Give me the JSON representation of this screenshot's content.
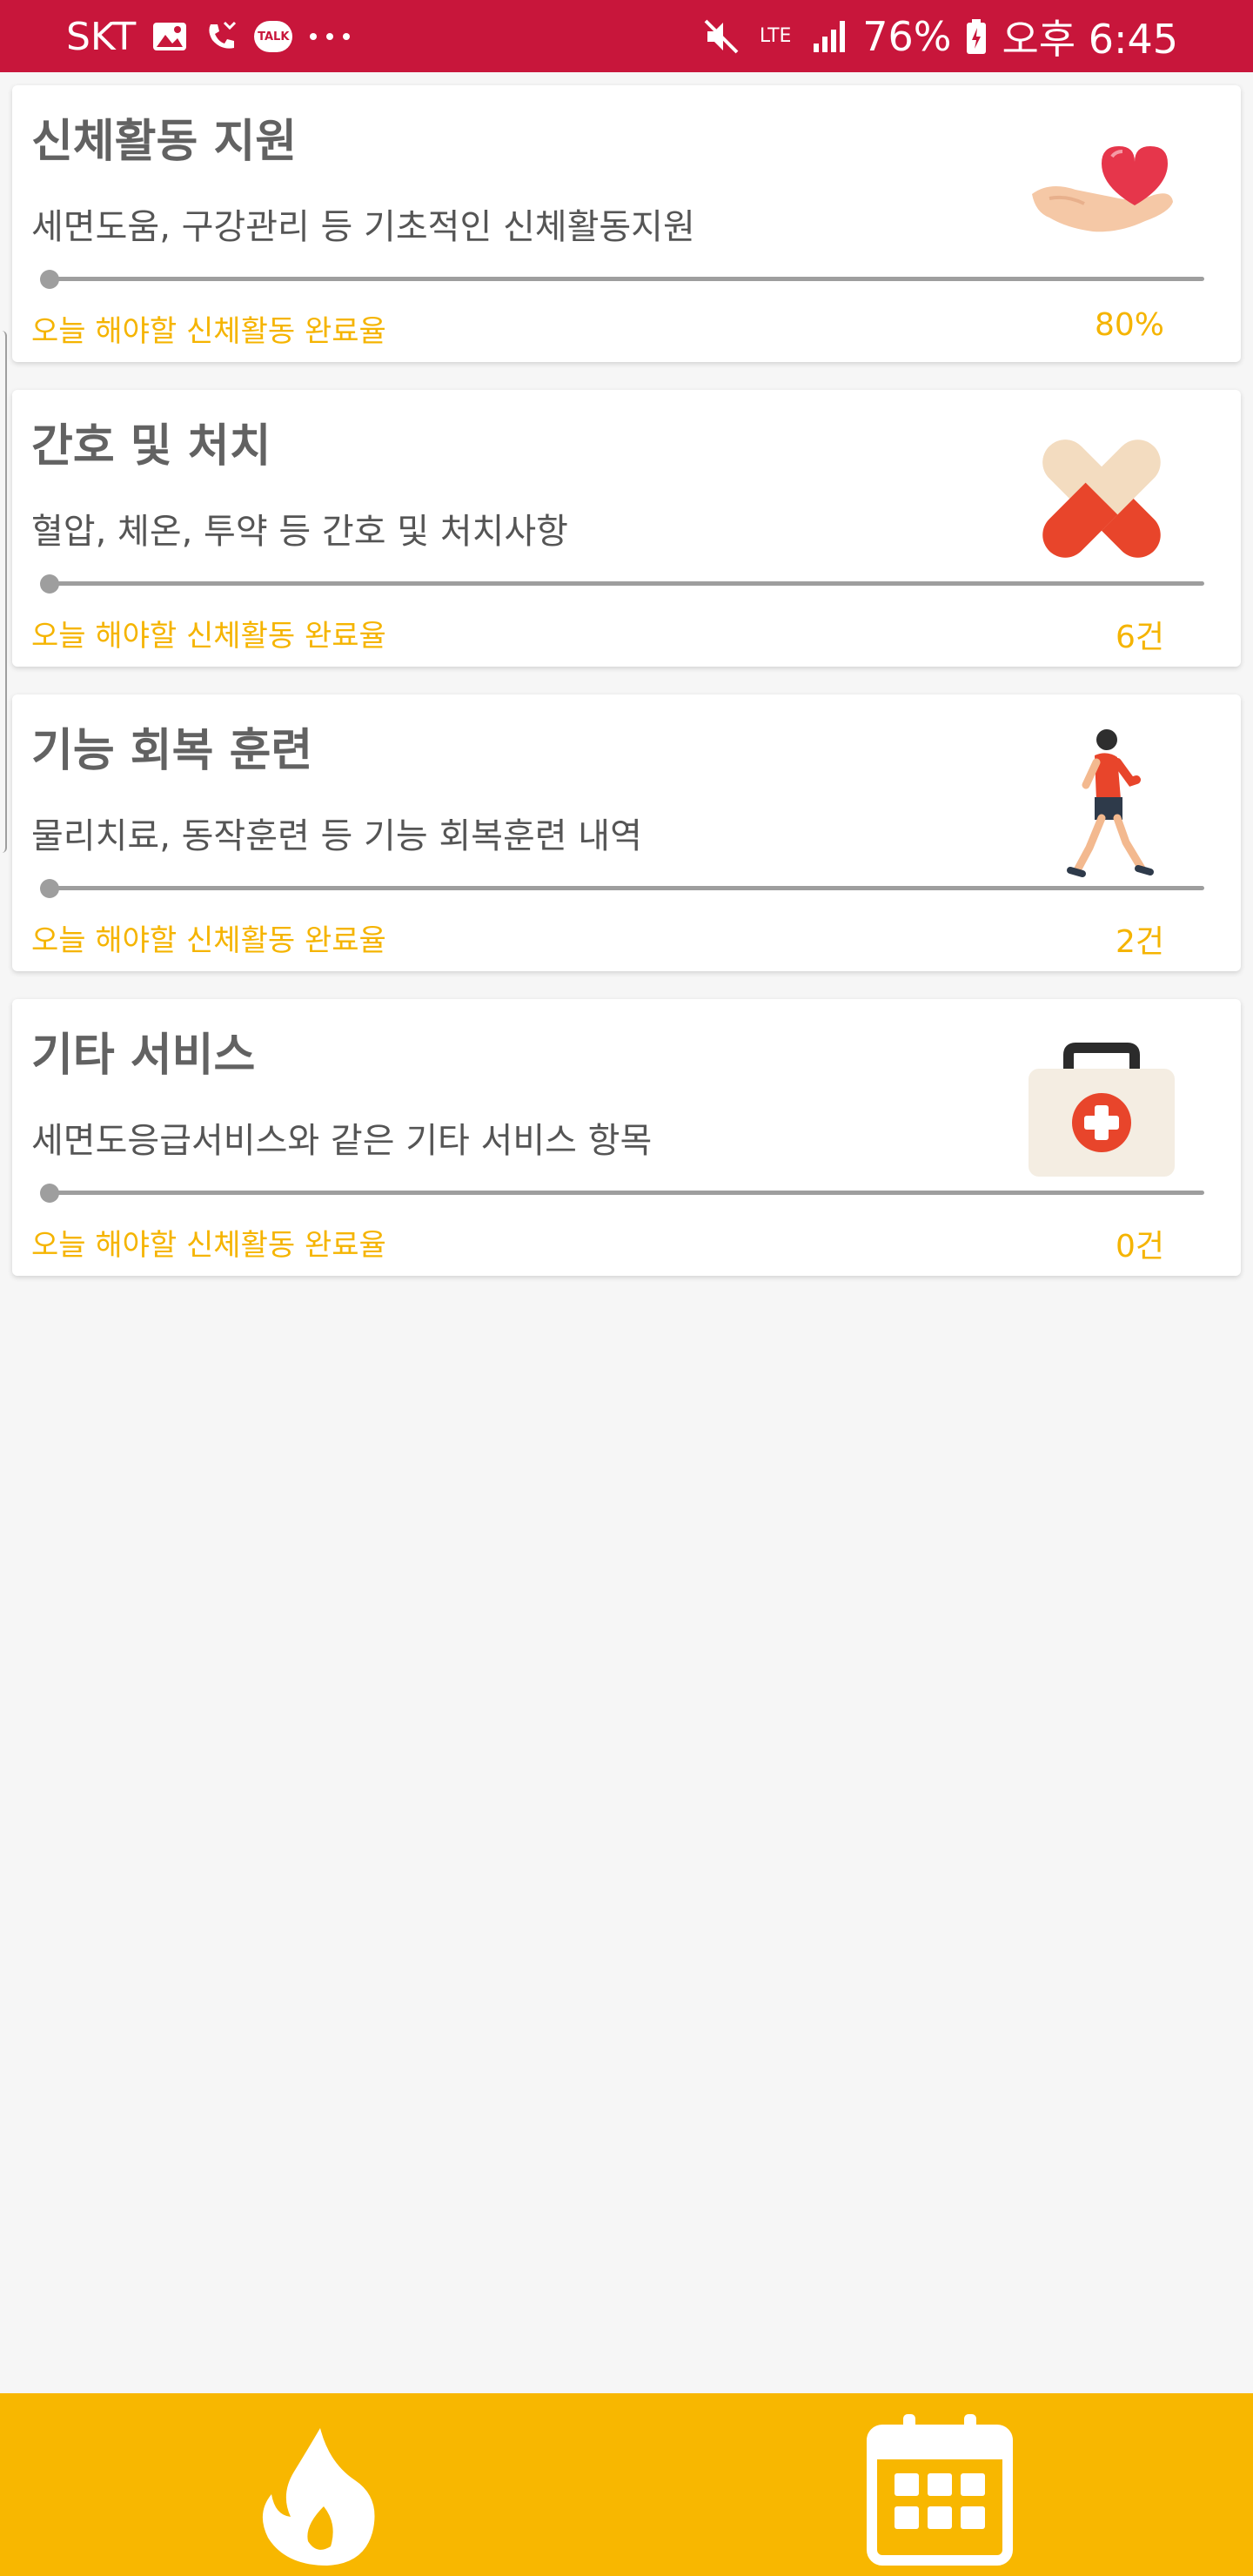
{
  "status_bar": {
    "carrier": "SKT",
    "battery": "76%",
    "time": "오후 6:45",
    "lte": "LTE",
    "icons": [
      "gallery-icon",
      "missed-call-icon",
      "kakaotalk-icon",
      "more-icon",
      "mute-icon",
      "signal-icon",
      "battery-icon"
    ]
  },
  "cards": [
    {
      "title": "신체활동 지원",
      "description": "세면도움, 구강관리 등 기초적인 신체활동지원",
      "footer_label": "오늘 해야할 신체활동 완료율",
      "value": "80%",
      "progress": 0.0,
      "icon": "heart-hand-icon"
    },
    {
      "title": "간호 및 처치",
      "description": "혈압, 체온, 투약 등 간호 및 처치사항",
      "footer_label": "오늘 해야할 신체활동 완료율",
      "value": "6건",
      "progress": 0.0,
      "icon": "pill-icon"
    },
    {
      "title": "기능 회복 훈련",
      "description": "물리치료, 동작훈련 등 기능 회복훈련 내역",
      "footer_label": "오늘 해야할 신체활동 완료율",
      "value": "2건",
      "progress": 0.0,
      "icon": "runner-icon"
    },
    {
      "title": "기타 서비스",
      "description": "세면도응급서비스와 같은 기타 서비스 항목",
      "footer_label": "오늘 해야할 신체활동 완료율",
      "value": "0건",
      "progress": 0.0,
      "icon": "first-aid-kit-icon"
    }
  ],
  "bottom_nav": {
    "items": [
      {
        "icon": "flame-icon"
      },
      {
        "icon": "calendar-icon"
      }
    ]
  },
  "colors": {
    "status_bar": "#c8163b",
    "accent": "#f5b400",
    "nav_bar": "#f8b700"
  }
}
